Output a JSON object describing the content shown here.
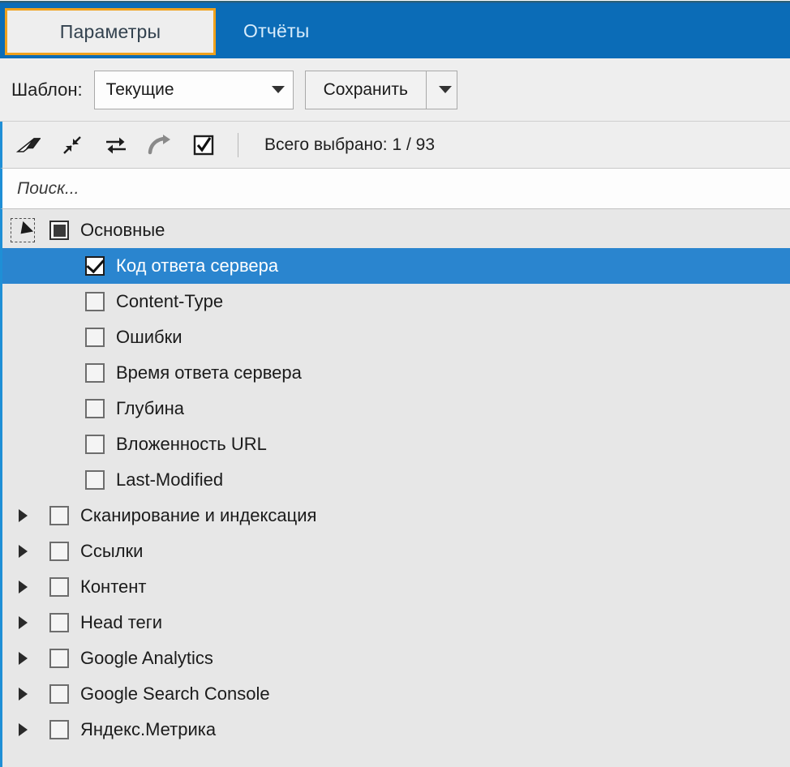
{
  "window": {
    "accent_blue": "#0b6cb7",
    "selection_blue": "#2a85cf",
    "tab_border_orange": "#f0a11c",
    "panel_gray": "#e7e7e7"
  },
  "tabs": [
    {
      "label": "Параметры",
      "active": true
    },
    {
      "label": "Отчёты",
      "active": false
    }
  ],
  "template_bar": {
    "label": "Шаблон:",
    "combo_value": "Текущие",
    "combo_options": [
      "Текущие"
    ],
    "save_label": "Сохранить",
    "dropdown_icon": "caret-down-icon"
  },
  "toolbar": {
    "buttons": [
      {
        "name": "eraser-icon",
        "title": "eraser"
      },
      {
        "name": "collapse-icon",
        "title": "collapse"
      },
      {
        "name": "swap-icon",
        "title": "swap"
      },
      {
        "name": "redo-icon",
        "title": "redo"
      },
      {
        "name": "check-all-icon",
        "title": "check-all"
      }
    ],
    "count_text": "Всего выбрано: 1 / 93"
  },
  "search": {
    "placeholder": "Поиск...",
    "value": ""
  },
  "tree": {
    "rows": [
      {
        "label": "Основные",
        "level": 0,
        "expander": "down",
        "expander_focus": true,
        "check": "indeterminate",
        "selected": false
      },
      {
        "label": "Код ответа сервера",
        "level": 1,
        "expander": "none",
        "expander_focus": false,
        "check": "checked",
        "selected": true
      },
      {
        "label": "Content-Type",
        "level": 1,
        "expander": "none",
        "expander_focus": false,
        "check": "unchecked",
        "selected": false
      },
      {
        "label": "Ошибки",
        "level": 1,
        "expander": "none",
        "expander_focus": false,
        "check": "unchecked",
        "selected": false
      },
      {
        "label": "Время ответа сервера",
        "level": 1,
        "expander": "none",
        "expander_focus": false,
        "check": "unchecked",
        "selected": false
      },
      {
        "label": "Глубина",
        "level": 1,
        "expander": "none",
        "expander_focus": false,
        "check": "unchecked",
        "selected": false
      },
      {
        "label": "Вложенность URL",
        "level": 1,
        "expander": "none",
        "expander_focus": false,
        "check": "unchecked",
        "selected": false
      },
      {
        "label": "Last-Modified",
        "level": 1,
        "expander": "none",
        "expander_focus": false,
        "check": "unchecked",
        "selected": false
      },
      {
        "label": "Сканирование и индексация",
        "level": 0,
        "expander": "right",
        "expander_focus": false,
        "check": "unchecked",
        "selected": false
      },
      {
        "label": "Ссылки",
        "level": 0,
        "expander": "right",
        "expander_focus": false,
        "check": "unchecked",
        "selected": false
      },
      {
        "label": "Контент",
        "level": 0,
        "expander": "right",
        "expander_focus": false,
        "check": "unchecked",
        "selected": false
      },
      {
        "label": "Head теги",
        "level": 0,
        "expander": "right",
        "expander_focus": false,
        "check": "unchecked",
        "selected": false
      },
      {
        "label": "Google Analytics",
        "level": 0,
        "expander": "right",
        "expander_focus": false,
        "check": "unchecked",
        "selected": false
      },
      {
        "label": "Google Search Console",
        "level": 0,
        "expander": "right",
        "expander_focus": false,
        "check": "unchecked",
        "selected": false
      },
      {
        "label": "Яндекс.Метрика",
        "level": 0,
        "expander": "right",
        "expander_focus": false,
        "check": "unchecked",
        "selected": false
      }
    ]
  }
}
